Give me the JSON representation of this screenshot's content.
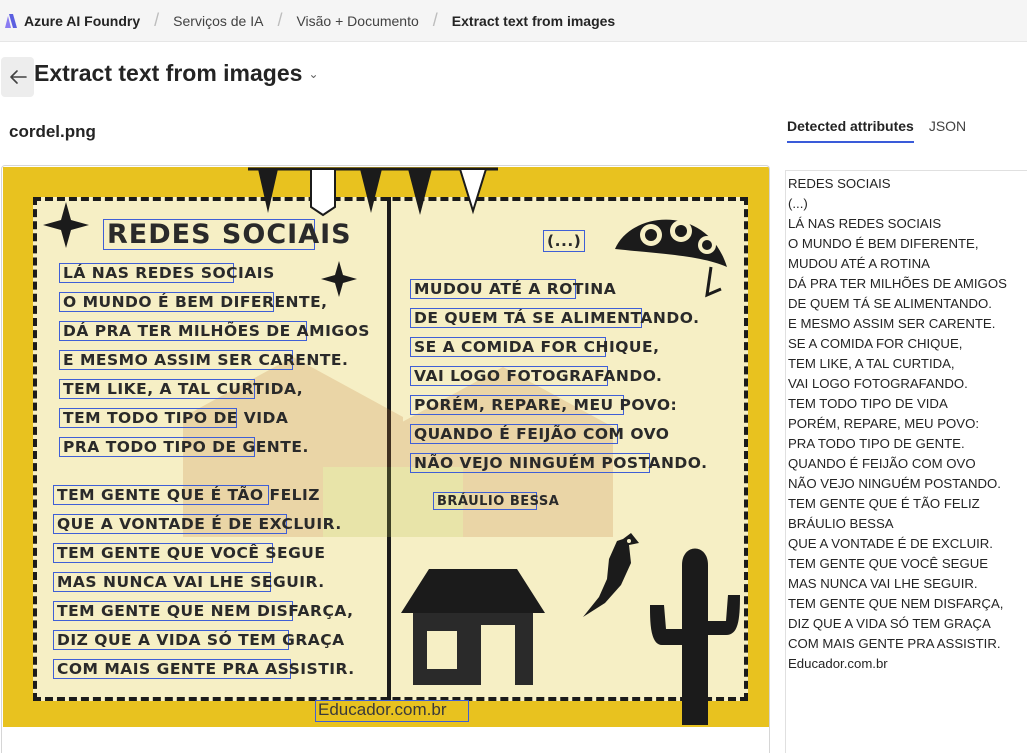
{
  "breadcrumb": {
    "items": [
      {
        "label": "Azure AI Foundry"
      },
      {
        "label": "Serviços de IA"
      },
      {
        "label": "Visão + Documento"
      },
      {
        "label": "Extract text from images"
      }
    ]
  },
  "header": {
    "title": "Extract text from images",
    "back_icon": "arrow-left-icon",
    "dropdown_icon": "chevron-down-icon"
  },
  "file": {
    "name": "cordel.png"
  },
  "tabs": [
    {
      "label": "Detected attributes",
      "active": true
    },
    {
      "label": "JSON",
      "active": false
    }
  ],
  "results": {
    "lines": [
      "REDES SOCIAIS",
      "(...)",
      "LÁ NAS REDES SOCIAIS",
      "O MUNDO É BEM DIFERENTE,",
      "MUDOU ATÉ A ROTINA",
      "DÁ PRA TER MILHÕES DE AMIGOS",
      "DE QUEM TÁ SE ALIMENTANDO.",
      "E MESMO ASSIM SER CARENTE.",
      "SE A COMIDA FOR CHIQUE,",
      "TEM LIKE, A TAL CURTIDA,",
      "VAI LOGO FOTOGRAFANDO.",
      "TEM TODO TIPO DE VIDA",
      "PORÉM, REPARE, MEU POVO:",
      "PRA TODO TIPO DE GENTE.",
      "QUANDO É FEIJÃO COM OVO",
      "NÃO VEJO NINGUÉM POSTANDO.",
      "TEM GENTE QUE É TÃO FELIZ",
      "BRÁULIO BESSA",
      "QUE A VONTADE É DE EXCLUIR.",
      "TEM GENTE QUE VOCÊ SEGUE",
      "MAS NUNCA VAI LHE SEGUIR.",
      "TEM GENTE QUE NEM DISFARÇA,",
      "DIZ QUE A VIDA SÓ TEM GRAÇA",
      "COM MAIS GENTE PRA ASSISTIR.",
      "Educador.com.br"
    ]
  },
  "image": {
    "title": "REDES SOCIAIS",
    "ellipsis": "(...)",
    "left_stanza_1": [
      "LÁ NAS REDES SOCIAIS",
      "O MUNDO É BEM DIFERENTE,",
      "DÁ PRA TER MILHÕES DE AMIGOS",
      "E MESMO ASSIM SER CARENTE.",
      "TEM LIKE, A TAL CURTIDA,",
      "TEM TODO TIPO DE VIDA",
      "PRA TODO TIPO DE GENTE."
    ],
    "left_stanza_2": [
      "TEM GENTE QUE É TÃO FELIZ",
      "QUE A VONTADE É DE EXCLUIR.",
      "TEM GENTE QUE VOCÊ SEGUE",
      "MAS NUNCA VAI LHE SEGUIR.",
      "TEM GENTE QUE NEM DISFARÇA,",
      "DIZ QUE A VIDA SÓ TEM GRAÇA",
      "COM MAIS GENTE PRA ASSISTIR."
    ],
    "right_stanza": [
      "MUDOU ATÉ A ROTINA",
      "DE QUEM TÁ SE ALIMENTANDO.",
      "SE A COMIDA FOR CHIQUE,",
      "VAI LOGO FOTOGRAFANDO.",
      "PORÉM, REPARE, MEU POVO:",
      "QUANDO É FEIJÃO COM OVO",
      "NÃO VEJO NINGUÉM POSTANDO."
    ],
    "signature": "BRÁULIO BESSA",
    "footer": "Educador.com.br"
  },
  "colors": {
    "accent": "#3a5bd9",
    "box": "#3f5fd6",
    "cordel_yellow": "#e8c21f",
    "paper": "#f6efc5"
  }
}
